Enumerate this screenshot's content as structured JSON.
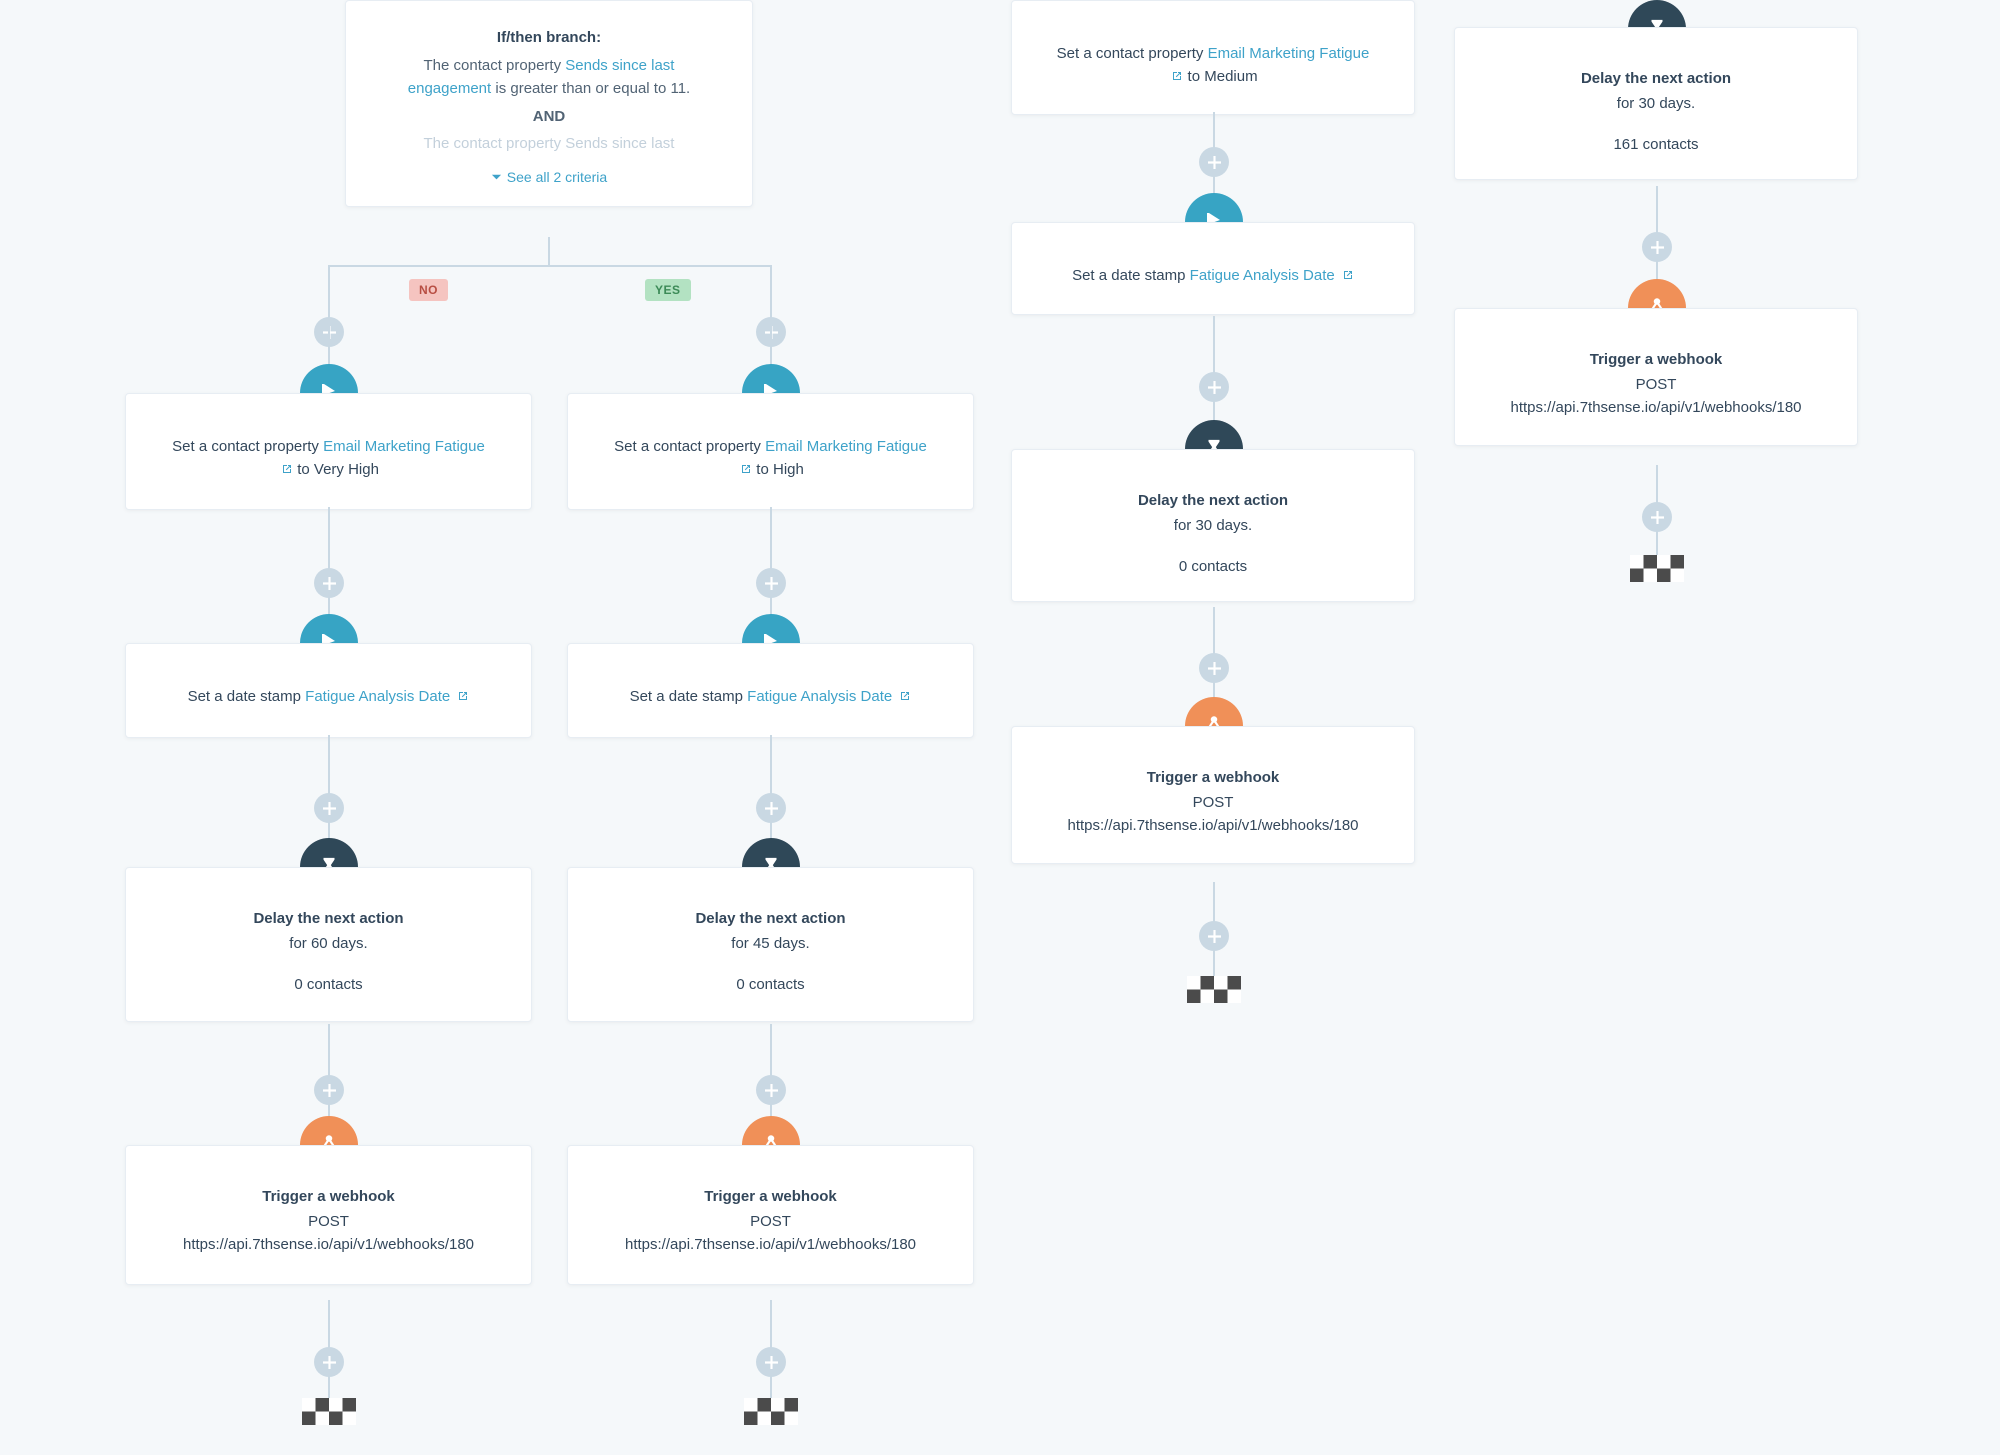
{
  "branch": {
    "title": "If/then branch:",
    "line1_pre": "The contact property ",
    "line1_link": "Sends since last engagement",
    "line1_post": " is greater than or equal to 11.",
    "and": "AND",
    "line2_pre": "The contact property ",
    "line2_link": "Sends since last",
    "see_all": "See all 2 criteria",
    "no": "NO",
    "yes": "YES"
  },
  "labels": {
    "set_prop": "Set a contact property ",
    "email_fatigue": "Email Marketing Fatigue",
    "to_vhigh": " to Very High",
    "to_high": " to High",
    "to_medium": " to Medium",
    "set_date": "Set a date stamp ",
    "fatigue_date": "Fatigue Analysis Date",
    "delay_title": "Delay the next action",
    "for60": "for 60 days.",
    "for45": "for 45 days.",
    "for30": "for 30 days.",
    "c0": "0 contacts",
    "c161": "161 contacts",
    "webhook_title": "Trigger a webhook",
    "post": "POST",
    "url": "https://api.7thsense.io/api/v1/webhooks/180"
  }
}
